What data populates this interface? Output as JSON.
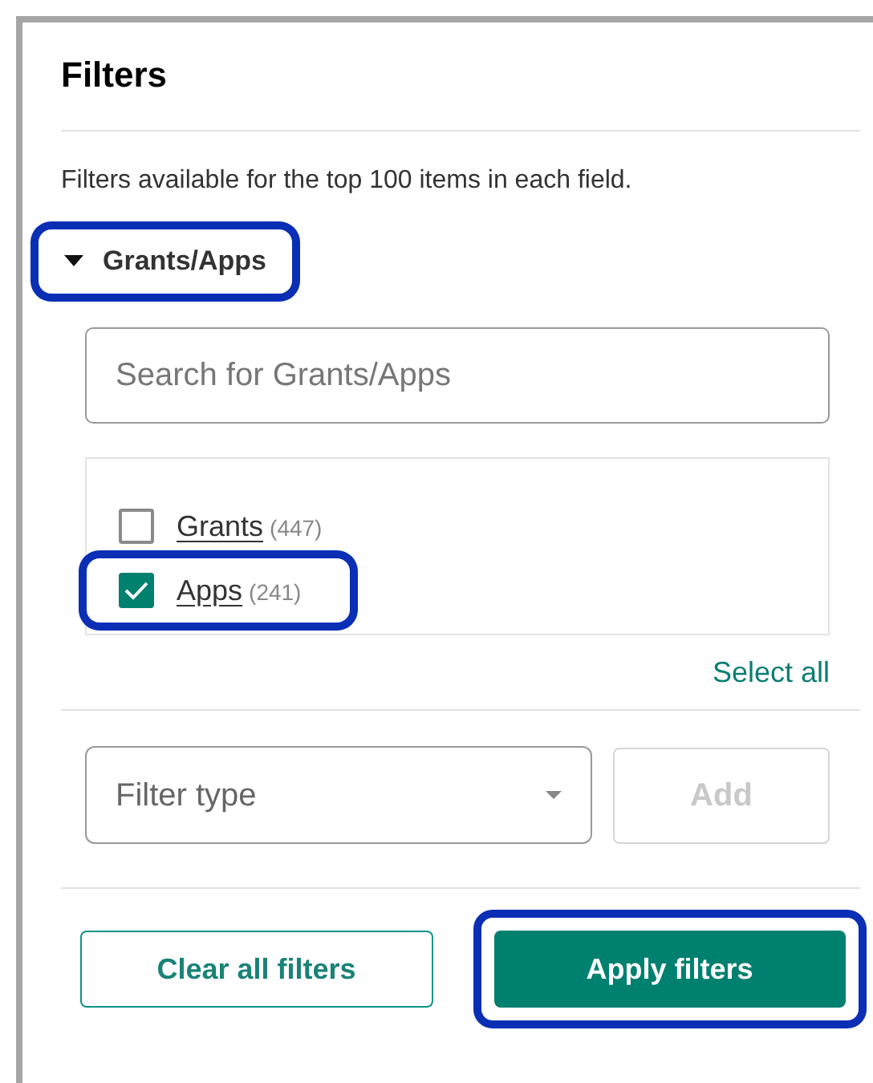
{
  "panel": {
    "title": "Filters",
    "description": "Filters available for the top 100 items in each field."
  },
  "section": {
    "label": "Grants/Apps",
    "expanded": true,
    "highlighted": true,
    "search": {
      "placeholder": "Search for Grants/Apps"
    },
    "options": [
      {
        "label": "Grants",
        "count": "(447)",
        "checked": false,
        "highlighted": false
      },
      {
        "label": "Apps",
        "count": "(241)",
        "checked": true,
        "highlighted": true
      }
    ],
    "select_all": "Select all"
  },
  "filter_type": {
    "placeholder": "Filter type"
  },
  "add_button": {
    "label": "Add",
    "disabled": true
  },
  "buttons": [
    {
      "label": "Clear all filters",
      "kind": "secondary",
      "highlighted": false
    },
    {
      "label": "Apply filters",
      "kind": "primary",
      "highlighted": true
    }
  ]
}
